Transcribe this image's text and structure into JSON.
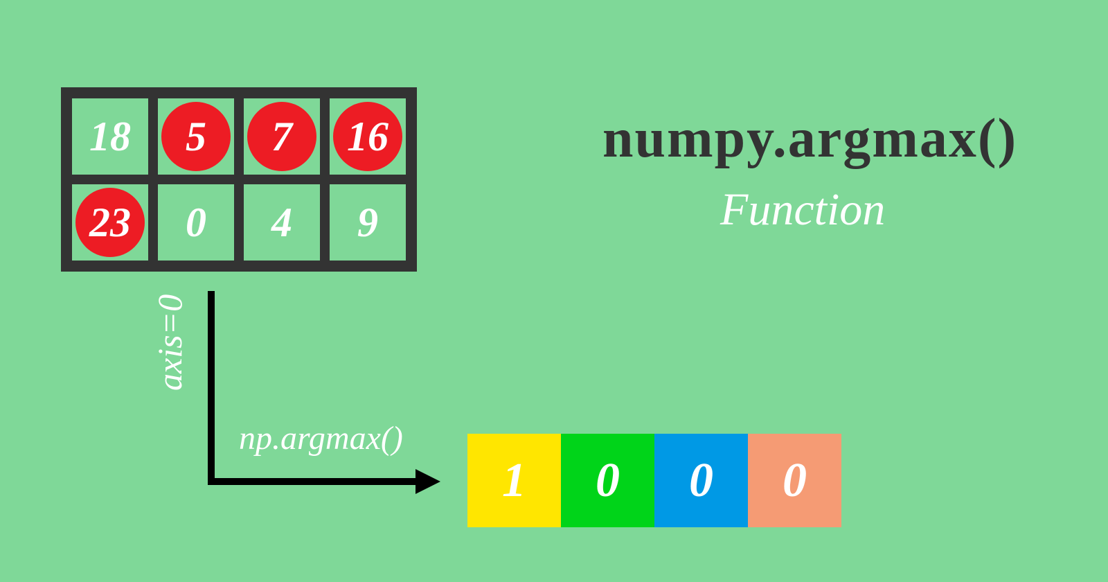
{
  "grid": {
    "rows": [
      [
        {
          "value": "18",
          "highlighted": false
        },
        {
          "value": "5",
          "highlighted": true
        },
        {
          "value": "7",
          "highlighted": true
        },
        {
          "value": "16",
          "highlighted": true
        }
      ],
      [
        {
          "value": "23",
          "highlighted": true
        },
        {
          "value": "0",
          "highlighted": false
        },
        {
          "value": "4",
          "highlighted": false
        },
        {
          "value": "9",
          "highlighted": false
        }
      ]
    ]
  },
  "title": {
    "main": "numpy.argmax()",
    "sub": "Function"
  },
  "labels": {
    "axis": "axis=0",
    "func": "np.argmax()"
  },
  "result": {
    "values": [
      "1",
      "0",
      "0",
      "0"
    ],
    "colors": [
      "#ffe600",
      "#00d419",
      "#0099e5",
      "#f59b74"
    ]
  }
}
